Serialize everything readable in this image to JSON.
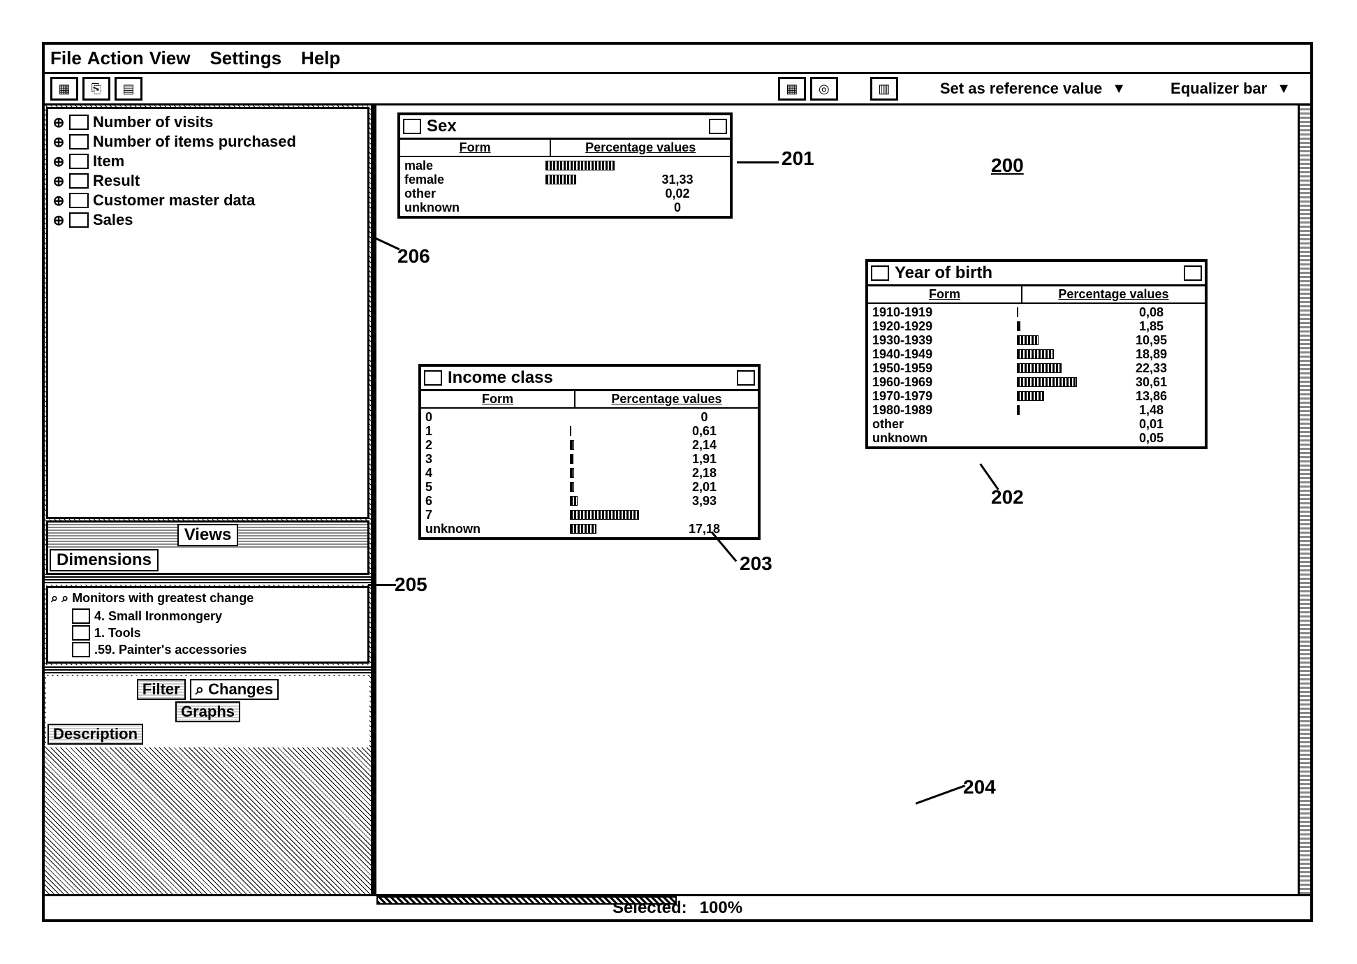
{
  "menu": {
    "file": "File",
    "action": "Action",
    "view": "View",
    "settings": "Settings",
    "help": "Help"
  },
  "toolbar": {
    "ref": "Set as reference value",
    "eq": "Equalizer bar"
  },
  "tree": [
    {
      "label": "Number of visits"
    },
    {
      "label": "Number of items purchased"
    },
    {
      "label": "Item"
    },
    {
      "label": "Result"
    },
    {
      "label": "Customer master data"
    },
    {
      "label": "Sales"
    }
  ],
  "side_tabs": {
    "views": "Views",
    "dimensions": "Dimensions"
  },
  "monitors": {
    "title": "Monitors with greatest change",
    "items": [
      {
        "label": "4. Small Ironmongery"
      },
      {
        "label": "1. Tools"
      },
      {
        "label": ".59. Painter's accessories"
      }
    ]
  },
  "bottom_tabs": {
    "filter": "Filter",
    "changes": "Changes",
    "graphs": "Graphs",
    "description": "Description"
  },
  "panels": {
    "sex": {
      "title": "Sex",
      "headers": {
        "form": "Form",
        "pct": "Percentage values"
      },
      "rows": [
        {
          "label": "male",
          "bar": 90,
          "val": "",
          "hl": true
        },
        {
          "label": "female",
          "bar": 40,
          "val": "31,33"
        },
        {
          "label": "other",
          "bar": 0,
          "val": "0,02"
        },
        {
          "label": "unknown",
          "bar": 0,
          "val": "0"
        }
      ]
    },
    "income": {
      "title": "Income class",
      "headers": {
        "form": "Form",
        "pct": "Percentage values"
      },
      "rows": [
        {
          "label": "0",
          "bar": 0,
          "val": "0"
        },
        {
          "label": "1",
          "bar": 2,
          "val": "0,61"
        },
        {
          "label": "2",
          "bar": 6,
          "val": "2,14"
        },
        {
          "label": "3",
          "bar": 5,
          "val": "1,91"
        },
        {
          "label": "4",
          "bar": 6,
          "val": "2,18"
        },
        {
          "label": "5",
          "bar": 6,
          "val": "2,01"
        },
        {
          "label": "6",
          "bar": 10,
          "val": "3,93"
        },
        {
          "label": "7",
          "bar": 90,
          "val": "",
          "hl": true
        },
        {
          "label": "unknown",
          "bar": 35,
          "val": "17,18"
        }
      ]
    },
    "yob": {
      "title": "Year of birth",
      "headers": {
        "form": "Form",
        "pct": "Percentage values"
      },
      "rows": [
        {
          "label": "1910-1919",
          "bar": 1,
          "val": "0,08"
        },
        {
          "label": "1920-1929",
          "bar": 5,
          "val": "1,85"
        },
        {
          "label": "1930-1939",
          "bar": 28,
          "val": "10,95"
        },
        {
          "label": "1940-1949",
          "bar": 48,
          "val": "18,89"
        },
        {
          "label": "1950-1959",
          "bar": 58,
          "val": "22,33"
        },
        {
          "label": "1960-1969",
          "bar": 78,
          "val": "30,61"
        },
        {
          "label": "1970-1979",
          "bar": 36,
          "val": "13,86"
        },
        {
          "label": "1980-1989",
          "bar": 4,
          "val": "1,48"
        },
        {
          "label": "other",
          "bar": 0,
          "val": "0,01"
        },
        {
          "label": "unknown",
          "bar": 0,
          "val": "0,05"
        }
      ]
    }
  },
  "annotations": {
    "a200": "200",
    "a201": "201",
    "a202": "202",
    "a203": "203",
    "a204": "204",
    "a205": "205",
    "a206": "206"
  },
  "status": {
    "selected_label": "Selected:",
    "selected_val": "100%"
  },
  "chart_data": [
    {
      "type": "bar",
      "title": "Sex",
      "xlabel": "Form",
      "ylabel": "Percentage values",
      "categories": [
        "male",
        "female",
        "other",
        "unknown"
      ],
      "values": [
        68.65,
        31.33,
        0.02,
        0
      ]
    },
    {
      "type": "bar",
      "title": "Income class",
      "xlabel": "Form",
      "ylabel": "Percentage values",
      "categories": [
        "0",
        "1",
        "2",
        "3",
        "4",
        "5",
        "6",
        "7",
        "unknown"
      ],
      "values": [
        0,
        0.61,
        2.14,
        1.91,
        2.18,
        2.01,
        3.93,
        70.04,
        17.18
      ]
    },
    {
      "type": "bar",
      "title": "Year of birth",
      "xlabel": "Form",
      "ylabel": "Percentage values",
      "categories": [
        "1910-1919",
        "1920-1929",
        "1930-1939",
        "1940-1949",
        "1950-1959",
        "1960-1969",
        "1970-1979",
        "1980-1989",
        "other",
        "unknown"
      ],
      "values": [
        0.08,
        1.85,
        10.95,
        18.89,
        22.33,
        30.61,
        13.86,
        1.48,
        0.01,
        0.05
      ]
    }
  ]
}
